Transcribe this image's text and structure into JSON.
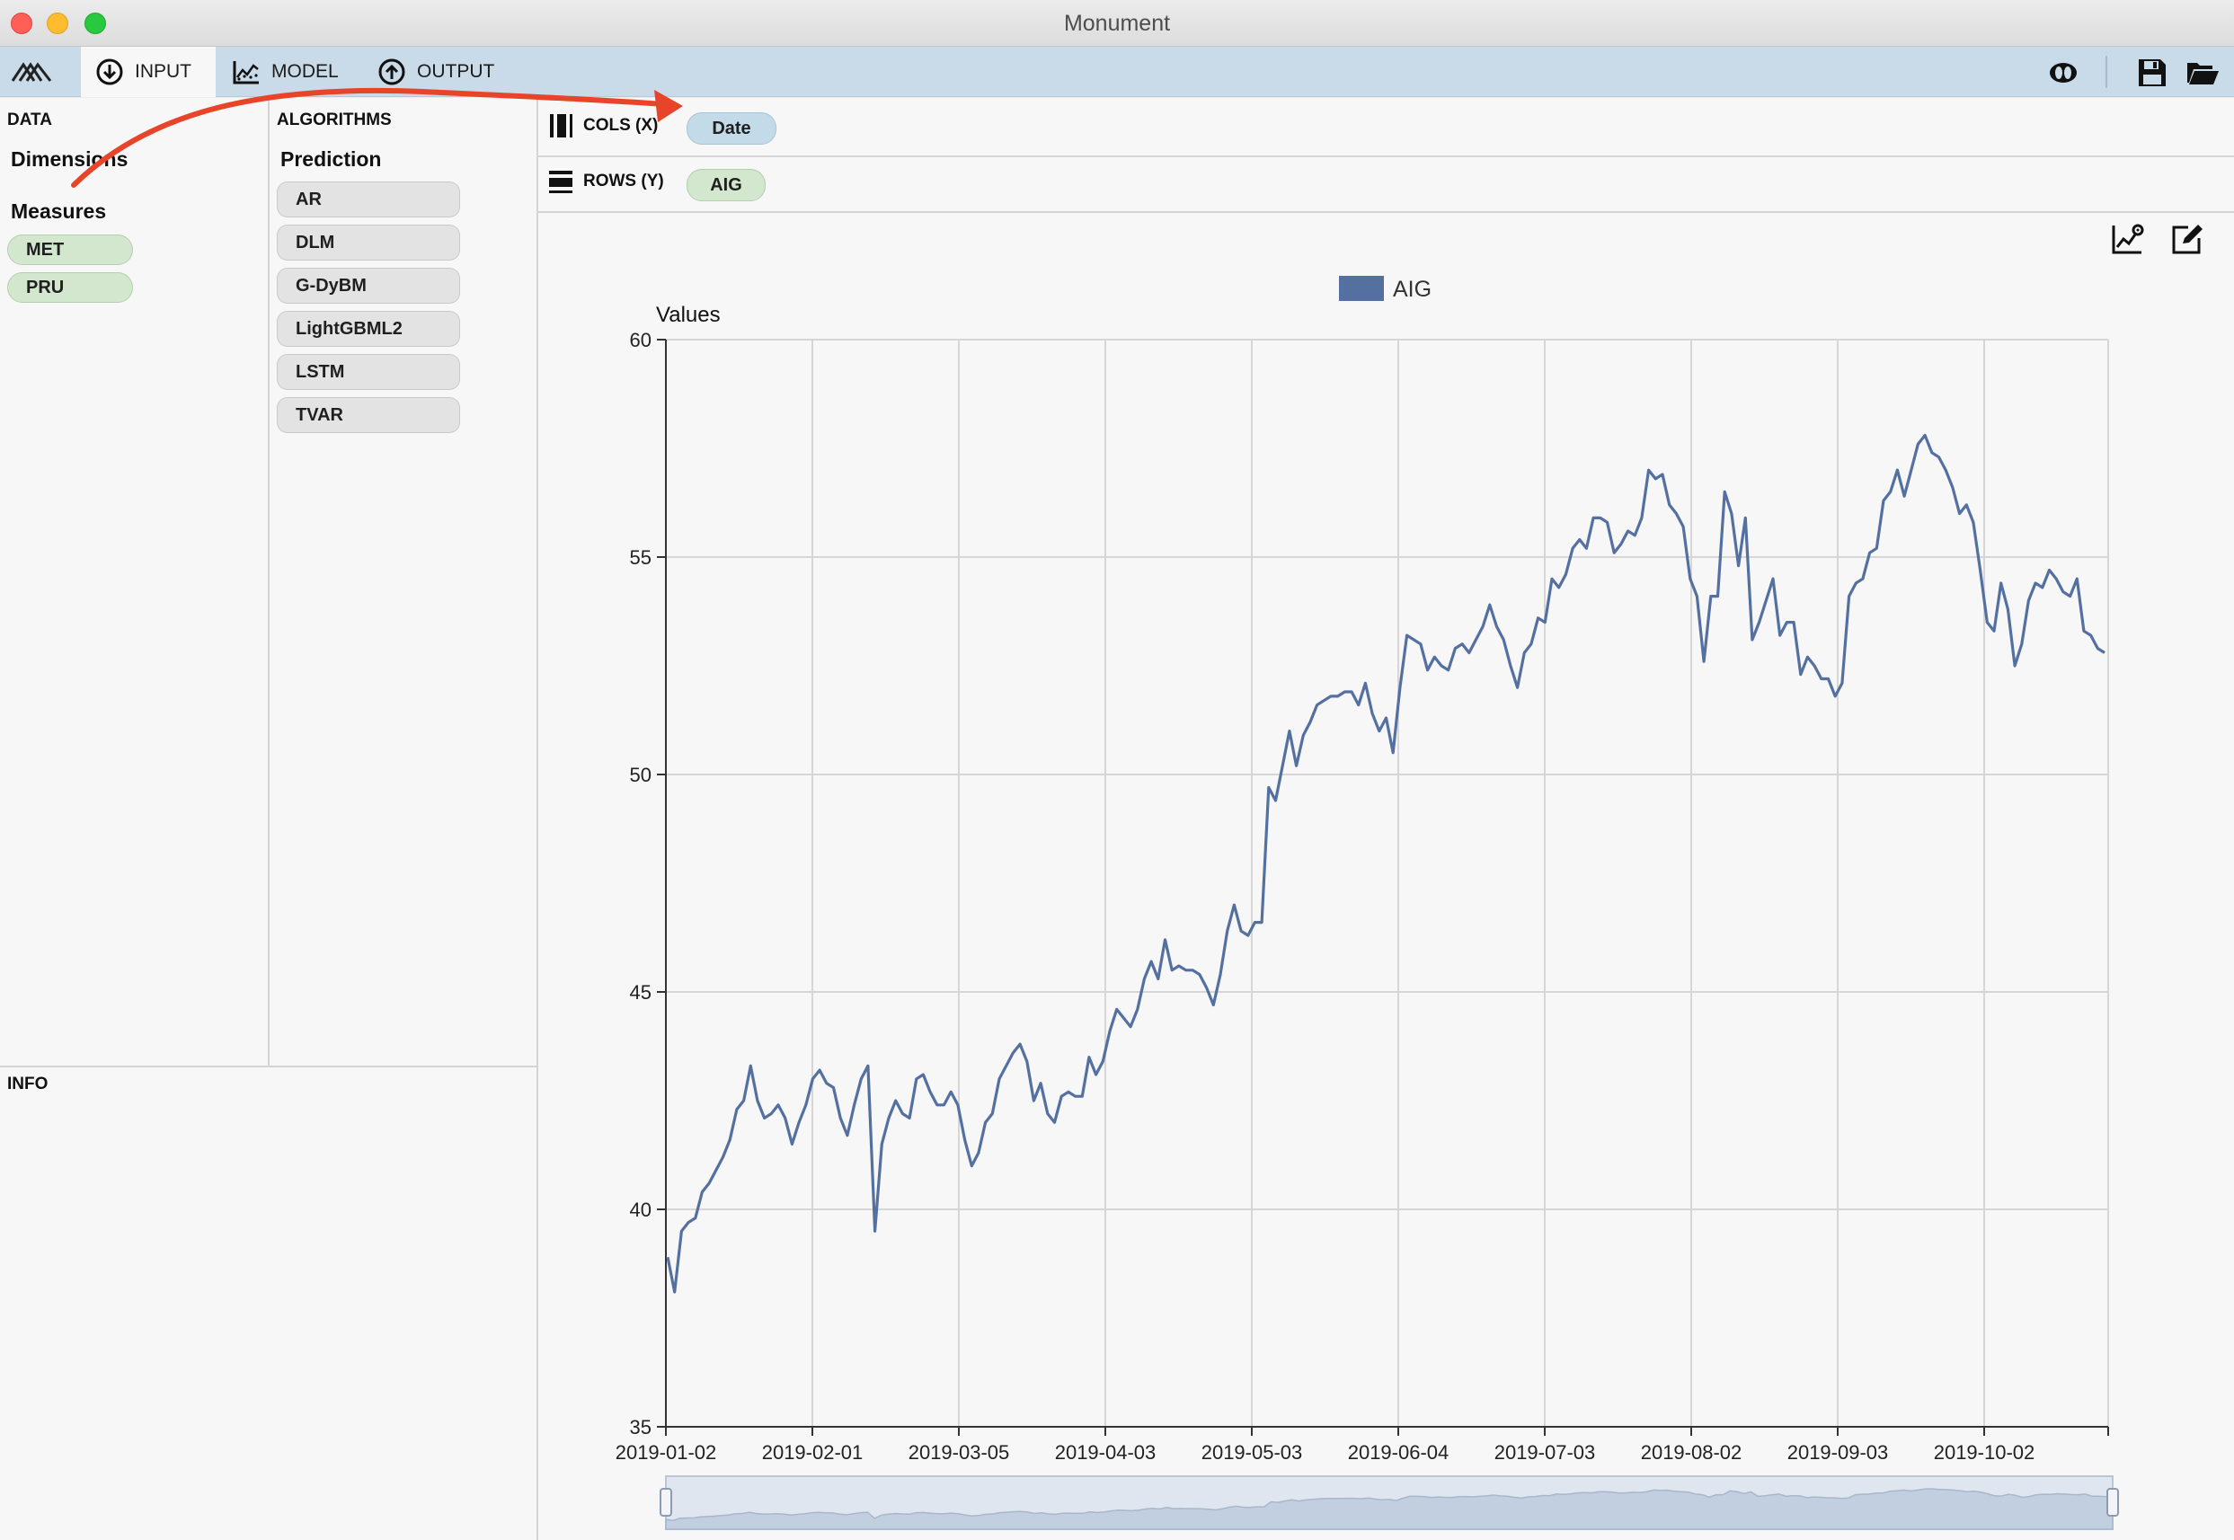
{
  "window": {
    "title": "Monument"
  },
  "toolbar": {
    "tabs": [
      {
        "label": "INPUT",
        "icon": "arrow-down-circle-icon",
        "active": true
      },
      {
        "label": "MODEL",
        "icon": "chart-model-icon",
        "active": false
      },
      {
        "label": "OUTPUT",
        "icon": "arrow-up-circle-icon",
        "active": false
      }
    ],
    "right_icons": [
      "toggle-view-icon",
      "save-icon",
      "open-folder-icon"
    ]
  },
  "data_panel": {
    "title": "DATA",
    "dimensions_label": "Dimensions",
    "measures_label": "Measures",
    "measures": [
      "MET",
      "PRU"
    ]
  },
  "algorithms_panel": {
    "title": "ALGORITHMS",
    "group_label": "Prediction",
    "items": [
      "AR",
      "DLM",
      "G-DyBM",
      "LightGBML2",
      "LSTM",
      "TVAR"
    ]
  },
  "info_panel": {
    "title": "INFO"
  },
  "shelves": {
    "cols_label": "COLS (X)",
    "cols_value": "Date",
    "rows_label": "ROWS (Y)",
    "rows_value": "AIG"
  },
  "chart_icons": [
    "chart-settings-icon",
    "edit-icon"
  ],
  "colors": {
    "toolbar": "#c9dbe8",
    "series": "#5470a0",
    "measure_pill": "#d3e7cf",
    "dimension_pill": "#c3dae8",
    "annotation_arrow": "#e8442a"
  },
  "chart_data": {
    "type": "line",
    "ylabel": "Values",
    "ylim": [
      35,
      60
    ],
    "y_ticks": [
      "35",
      "40",
      "45",
      "50",
      "55",
      "60"
    ],
    "x_ticks": [
      "2019-01-02",
      "2019-02-01",
      "2019-03-05",
      "2019-04-03",
      "2019-05-03",
      "2019-06-04",
      "2019-07-03",
      "2019-08-02",
      "2019-09-03",
      "2019-10-02"
    ],
    "legend": {
      "position": "top-center"
    },
    "grid": true,
    "series": [
      {
        "name": "AIG",
        "color": "#5470a0",
        "values": [
          38.9,
          38.1,
          39.5,
          39.7,
          39.8,
          40.4,
          40.6,
          40.9,
          41.2,
          41.6,
          42.3,
          42.5,
          43.3,
          42.5,
          42.1,
          42.2,
          42.4,
          42.1,
          41.5,
          42.0,
          42.4,
          43.0,
          43.2,
          42.9,
          42.8,
          42.1,
          41.7,
          42.4,
          43.0,
          43.3,
          39.5,
          41.5,
          42.1,
          42.5,
          42.2,
          42.1,
          43.0,
          43.1,
          42.7,
          42.4,
          42.4,
          42.7,
          42.4,
          41.6,
          41.0,
          41.3,
          42.0,
          42.2,
          43.0,
          43.3,
          43.6,
          43.8,
          43.4,
          42.5,
          42.9,
          42.2,
          42.0,
          42.6,
          42.7,
          42.6,
          42.6,
          43.5,
          43.1,
          43.4,
          44.1,
          44.6,
          44.4,
          44.2,
          44.6,
          45.3,
          45.7,
          45.3,
          46.2,
          45.5,
          45.6,
          45.5,
          45.5,
          45.4,
          45.1,
          44.7,
          45.4,
          46.4,
          47.0,
          46.4,
          46.3,
          46.6,
          46.6,
          49.7,
          49.4,
          50.2,
          51.0,
          50.2,
          50.9,
          51.2,
          51.6,
          51.7,
          51.8,
          51.8,
          51.9,
          51.9,
          51.6,
          52.1,
          51.4,
          51.0,
          51.3,
          50.5,
          52.0,
          53.2,
          53.1,
          53.0,
          52.4,
          52.7,
          52.5,
          52.4,
          52.9,
          53.0,
          52.8,
          53.1,
          53.4,
          53.9,
          53.4,
          53.1,
          52.5,
          52.0,
          52.8,
          53.0,
          53.6,
          53.5,
          54.5,
          54.3,
          54.6,
          55.2,
          55.4,
          55.2,
          55.9,
          55.9,
          55.8,
          55.1,
          55.3,
          55.6,
          55.5,
          55.9,
          57.0,
          56.8,
          56.9,
          56.2,
          56.0,
          55.7,
          54.5,
          54.1,
          52.6,
          54.1,
          54.1,
          56.5,
          56.0,
          54.8,
          55.9,
          53.1,
          53.5,
          54.0,
          54.5,
          53.2,
          53.5,
          53.5,
          52.3,
          52.7,
          52.5,
          52.2,
          52.2,
          51.8,
          52.1,
          54.1,
          54.4,
          54.5,
          55.1,
          55.2,
          56.3,
          56.5,
          57.0,
          56.4,
          57.0,
          57.6,
          57.8,
          57.4,
          57.3,
          57.0,
          56.6,
          56.0,
          56.2,
          55.8,
          54.7,
          53.5,
          53.3,
          54.4,
          53.8,
          52.5,
          53.0,
          54.0,
          54.4,
          54.3,
          54.7,
          54.5,
          54.2,
          54.1,
          54.5,
          53.3,
          53.2,
          52.9,
          52.8
        ]
      }
    ]
  }
}
